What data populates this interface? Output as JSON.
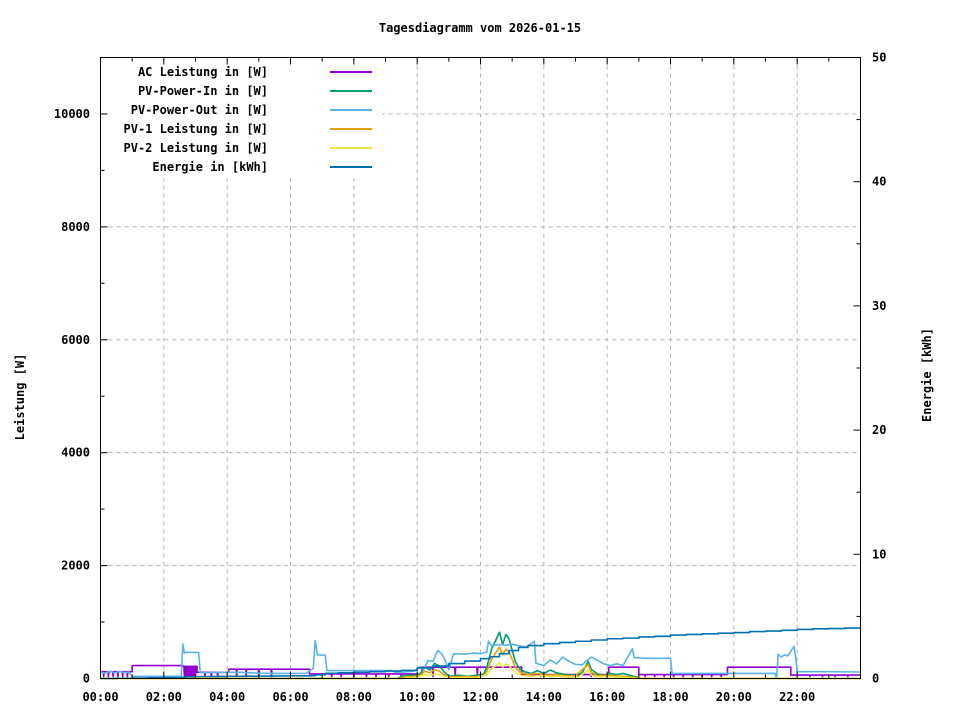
{
  "title": "Tagesdiagramm vom 2026-01-15",
  "axes": {
    "left": {
      "label": "Leistung [W]",
      "ticks": [
        0,
        2000,
        4000,
        6000,
        8000,
        10000
      ],
      "range": [
        0,
        11000
      ]
    },
    "right": {
      "label": "Energie [kWh]",
      "ticks": [
        0,
        10,
        20,
        30,
        40,
        50
      ],
      "range": [
        0,
        50
      ]
    },
    "x": {
      "tick_hours": [
        0,
        2,
        4,
        6,
        8,
        10,
        12,
        14,
        16,
        18,
        20,
        22
      ],
      "tick_labels": [
        "00:00",
        "02:00",
        "04:00",
        "06:00",
        "08:00",
        "10:00",
        "12:00",
        "14:00",
        "16:00",
        "18:00",
        "20:00",
        "22:00"
      ],
      "minor_hours": [
        1,
        3,
        5,
        7,
        9,
        11,
        13,
        15,
        17,
        19,
        21,
        23
      ],
      "range_hours": [
        0,
        24
      ]
    }
  },
  "colors": {
    "grid": "#b3b3b3",
    "axis": "#000000",
    "background": "#ffffff",
    "legend_bg": "#ffffff"
  },
  "chart_data": {
    "type": "line",
    "title": "Tagesdiagramm vom 2026-01-15",
    "x_unit": "hour_of_day",
    "grid": "dashed, on x majors (2h) and left-axis majors (2000 W)",
    "legend_position": "top-left, opaque white",
    "series": [
      {
        "name": "AC Leistung in [W]",
        "axis": "left",
        "color": "#9400d3",
        "points": [
          [
            0,
            120
          ],
          [
            1,
            120
          ],
          [
            1,
            230
          ],
          [
            2.6,
            230
          ],
          [
            2.6,
            215
          ],
          [
            3.05,
            215
          ],
          [
            3.05,
            110
          ],
          [
            4.05,
            110
          ],
          [
            4.05,
            165
          ],
          [
            6.6,
            165
          ],
          [
            6.6,
            80
          ],
          [
            10.15,
            80
          ],
          [
            10.15,
            200
          ],
          [
            13.3,
            200
          ],
          [
            13.3,
            70
          ],
          [
            16.05,
            70
          ],
          [
            16.05,
            200
          ],
          [
            17,
            200
          ],
          [
            17,
            70
          ],
          [
            19.8,
            70
          ],
          [
            19.8,
            200
          ],
          [
            21.8,
            200
          ],
          [
            21.8,
            60
          ],
          [
            24,
            60
          ]
        ],
        "dip_value": 35,
        "dips": [
          0.1,
          0.25,
          0.4,
          0.55,
          0.7,
          0.85,
          2.65,
          2.7,
          2.75,
          2.8,
          2.85,
          2.9,
          2.95,
          3.0,
          3.3,
          3.5,
          3.7,
          4.3,
          4.6,
          5.0,
          5.4,
          7.3,
          7.6,
          8.0,
          8.4,
          8.7,
          9.1,
          9.5,
          9.9,
          10.5,
          11.2,
          11.9,
          13.6,
          13.9,
          14.3,
          14.7,
          15.1,
          15.5,
          17.2,
          17.5,
          17.8,
          18.1,
          18.4,
          18.7,
          19.0,
          19.3,
          19.6,
          22.4,
          22.8,
          23.2,
          23.6
        ]
      },
      {
        "name": "PV-Power-In in [W]",
        "axis": "left",
        "color": "#009e73",
        "points": [
          [
            0,
            3
          ],
          [
            9.4,
            3
          ],
          [
            9.5,
            40
          ],
          [
            9.7,
            60
          ],
          [
            9.9,
            50
          ],
          [
            10.1,
            90
          ],
          [
            10.25,
            200
          ],
          [
            10.4,
            150
          ],
          [
            10.55,
            270
          ],
          [
            10.7,
            220
          ],
          [
            10.85,
            120
          ],
          [
            11,
            40
          ],
          [
            11.3,
            60
          ],
          [
            11.6,
            40
          ],
          [
            11.9,
            60
          ],
          [
            12.1,
            80
          ],
          [
            12.2,
            200
          ],
          [
            12.35,
            520
          ],
          [
            12.5,
            700
          ],
          [
            12.6,
            820
          ],
          [
            12.7,
            600
          ],
          [
            12.8,
            780
          ],
          [
            12.9,
            700
          ],
          [
            13,
            500
          ],
          [
            13.1,
            300
          ],
          [
            13.25,
            160
          ],
          [
            13.4,
            120
          ],
          [
            13.6,
            90
          ],
          [
            13.8,
            140
          ],
          [
            14,
            90
          ],
          [
            14.2,
            150
          ],
          [
            14.4,
            100
          ],
          [
            14.6,
            80
          ],
          [
            14.8,
            60
          ],
          [
            15,
            70
          ],
          [
            15.2,
            90
          ],
          [
            15.4,
            300
          ],
          [
            15.5,
            160
          ],
          [
            15.7,
            80
          ],
          [
            15.9,
            60
          ],
          [
            16.1,
            90
          ],
          [
            16.3,
            70
          ],
          [
            16.5,
            90
          ],
          [
            16.7,
            60
          ],
          [
            16.9,
            30
          ],
          [
            17.1,
            0
          ],
          [
            24,
            0
          ]
        ]
      },
      {
        "name": "PV-Power-Out in [W]",
        "axis": "left",
        "color": "#56b4e9",
        "points": [
          [
            0,
            110
          ],
          [
            0.15,
            95
          ],
          [
            0.3,
            130
          ],
          [
            0.45,
            100
          ],
          [
            0.6,
            125
          ],
          [
            0.75,
            105
          ],
          [
            0.9,
            115
          ],
          [
            1,
            40
          ],
          [
            2.55,
            40
          ],
          [
            2.6,
            610
          ],
          [
            2.65,
            450
          ],
          [
            2.7,
            465
          ],
          [
            3.1,
            460
          ],
          [
            3.15,
            100
          ],
          [
            3.5,
            105
          ],
          [
            4,
            110
          ],
          [
            4.5,
            108
          ],
          [
            5,
            95
          ],
          [
            5.5,
            90
          ],
          [
            6.5,
            92
          ],
          [
            6.72,
            180
          ],
          [
            6.78,
            670
          ],
          [
            6.85,
            420
          ],
          [
            7.1,
            410
          ],
          [
            7.15,
            140
          ],
          [
            8,
            140
          ],
          [
            9.2,
            140
          ],
          [
            9.3,
            110
          ],
          [
            9.6,
            115
          ],
          [
            9.9,
            130
          ],
          [
            10.1,
            210
          ],
          [
            10.2,
            160
          ],
          [
            10.35,
            320
          ],
          [
            10.5,
            300
          ],
          [
            10.65,
            500
          ],
          [
            10.8,
            420
          ],
          [
            10.9,
            300
          ],
          [
            11,
            150
          ],
          [
            11.15,
            440
          ],
          [
            11.5,
            430
          ],
          [
            11.8,
            450
          ],
          [
            12,
            440
          ],
          [
            12.2,
            470
          ],
          [
            12.25,
            660
          ],
          [
            12.35,
            580
          ],
          [
            12.6,
            600
          ],
          [
            12.8,
            590
          ],
          [
            13,
            610
          ],
          [
            13.2,
            580
          ],
          [
            13.45,
            560
          ],
          [
            13.7,
            660
          ],
          [
            13.75,
            270
          ],
          [
            14,
            230
          ],
          [
            14.2,
            330
          ],
          [
            14.4,
            260
          ],
          [
            14.6,
            380
          ],
          [
            14.8,
            300
          ],
          [
            15,
            250
          ],
          [
            15.2,
            240
          ],
          [
            15.5,
            380
          ],
          [
            15.7,
            320
          ],
          [
            15.9,
            260
          ],
          [
            16.1,
            230
          ],
          [
            16.3,
            260
          ],
          [
            16.5,
            230
          ],
          [
            16.8,
            530
          ],
          [
            16.85,
            370
          ],
          [
            17.2,
            360
          ],
          [
            17.5,
            355
          ],
          [
            18,
            360
          ],
          [
            18.05,
            90
          ],
          [
            19,
            90
          ],
          [
            20,
            90
          ],
          [
            21.3,
            90
          ],
          [
            21.35,
            0
          ],
          [
            21.4,
            430
          ],
          [
            21.5,
            380
          ],
          [
            21.6,
            420
          ],
          [
            21.7,
            400
          ],
          [
            21.9,
            570
          ],
          [
            21.95,
            400
          ],
          [
            22,
            120
          ],
          [
            23,
            120
          ],
          [
            24,
            115
          ]
        ]
      },
      {
        "name": "PV-1 Leistung in [W]",
        "axis": "left",
        "color": "#e69f00",
        "points": [
          [
            0,
            0
          ],
          [
            9.45,
            0
          ],
          [
            9.6,
            25
          ],
          [
            9.9,
            35
          ],
          [
            10.1,
            60
          ],
          [
            10.25,
            130
          ],
          [
            10.4,
            100
          ],
          [
            10.55,
            160
          ],
          [
            10.7,
            130
          ],
          [
            10.85,
            70
          ],
          [
            11,
            25
          ],
          [
            11.4,
            35
          ],
          [
            11.8,
            30
          ],
          [
            12.1,
            50
          ],
          [
            12.2,
            130
          ],
          [
            12.35,
            340
          ],
          [
            12.5,
            470
          ],
          [
            12.6,
            560
          ],
          [
            12.7,
            420
          ],
          [
            12.8,
            520
          ],
          [
            12.9,
            470
          ],
          [
            13,
            340
          ],
          [
            13.1,
            200
          ],
          [
            13.25,
            110
          ],
          [
            13.5,
            70
          ],
          [
            13.8,
            90
          ],
          [
            14.1,
            60
          ],
          [
            14.4,
            70
          ],
          [
            14.7,
            45
          ],
          [
            15,
            50
          ],
          [
            15.4,
            250
          ],
          [
            15.5,
            110
          ],
          [
            15.7,
            50
          ],
          [
            16,
            60
          ],
          [
            16.3,
            45
          ],
          [
            16.6,
            35
          ],
          [
            16.9,
            15
          ],
          [
            17.1,
            0
          ],
          [
            24,
            0
          ]
        ]
      },
      {
        "name": "PV-2 Leistung in [W]",
        "axis": "left",
        "color": "#f0e442",
        "points": [
          [
            0,
            0
          ],
          [
            9.55,
            0
          ],
          [
            9.7,
            15
          ],
          [
            10,
            25
          ],
          [
            10.25,
            70
          ],
          [
            10.4,
            50
          ],
          [
            10.55,
            80
          ],
          [
            10.7,
            65
          ],
          [
            10.9,
            35
          ],
          [
            11.1,
            15
          ],
          [
            11.5,
            20
          ],
          [
            11.9,
            15
          ],
          [
            12.2,
            70
          ],
          [
            12.35,
            180
          ],
          [
            12.5,
            230
          ],
          [
            12.6,
            280
          ],
          [
            12.7,
            200
          ],
          [
            12.8,
            260
          ],
          [
            12.9,
            230
          ],
          [
            13,
            160
          ],
          [
            13.1,
            100
          ],
          [
            13.3,
            55
          ],
          [
            13.6,
            40
          ],
          [
            13.9,
            50
          ],
          [
            14.2,
            35
          ],
          [
            14.5,
            40
          ],
          [
            14.8,
            25
          ],
          [
            15.1,
            30
          ],
          [
            15.4,
            150
          ],
          [
            15.5,
            60
          ],
          [
            15.7,
            30
          ],
          [
            16,
            35
          ],
          [
            16.3,
            25
          ],
          [
            16.6,
            15
          ],
          [
            16.8,
            5
          ],
          [
            17,
            0
          ],
          [
            24,
            0
          ]
        ]
      },
      {
        "name": "Energie in [kWh]",
        "axis": "right",
        "color": "#0072b2",
        "step": true,
        "points": [
          [
            0,
            0
          ],
          [
            0.5,
            0.02
          ],
          [
            1,
            0.04
          ],
          [
            1.5,
            0.06
          ],
          [
            2,
            0.08
          ],
          [
            2.6,
            0.1
          ],
          [
            2.7,
            0.14
          ],
          [
            3,
            0.16
          ],
          [
            3.5,
            0.17
          ],
          [
            4,
            0.18
          ],
          [
            4.5,
            0.19
          ],
          [
            5,
            0.2
          ],
          [
            5.5,
            0.21
          ],
          [
            6,
            0.22
          ],
          [
            6.7,
            0.24
          ],
          [
            6.8,
            0.3
          ],
          [
            7.1,
            0.42
          ],
          [
            7.5,
            0.46
          ],
          [
            8,
            0.5
          ],
          [
            8.5,
            0.55
          ],
          [
            9,
            0.6
          ],
          [
            9.5,
            0.65
          ],
          [
            10,
            0.85
          ],
          [
            10.5,
            1.0
          ],
          [
            11,
            1.2
          ],
          [
            11.5,
            1.4
          ],
          [
            12,
            1.6
          ],
          [
            12.3,
            1.75
          ],
          [
            12.6,
            2.0
          ],
          [
            12.9,
            2.25
          ],
          [
            13.2,
            2.5
          ],
          [
            13.5,
            2.65
          ],
          [
            14,
            2.8
          ],
          [
            14.5,
            2.9
          ],
          [
            15,
            3.0
          ],
          [
            15.5,
            3.1
          ],
          [
            16,
            3.2
          ],
          [
            16.5,
            3.25
          ],
          [
            17,
            3.35
          ],
          [
            17.5,
            3.4
          ],
          [
            18,
            3.5
          ],
          [
            18.5,
            3.55
          ],
          [
            19,
            3.6
          ],
          [
            19.5,
            3.65
          ],
          [
            20,
            3.7
          ],
          [
            20.5,
            3.78
          ],
          [
            21,
            3.82
          ],
          [
            21.5,
            3.88
          ],
          [
            22,
            3.95
          ],
          [
            22.5,
            4.0
          ],
          [
            23,
            4.02
          ],
          [
            23.5,
            4.06
          ],
          [
            24,
            4.1
          ]
        ]
      }
    ]
  }
}
